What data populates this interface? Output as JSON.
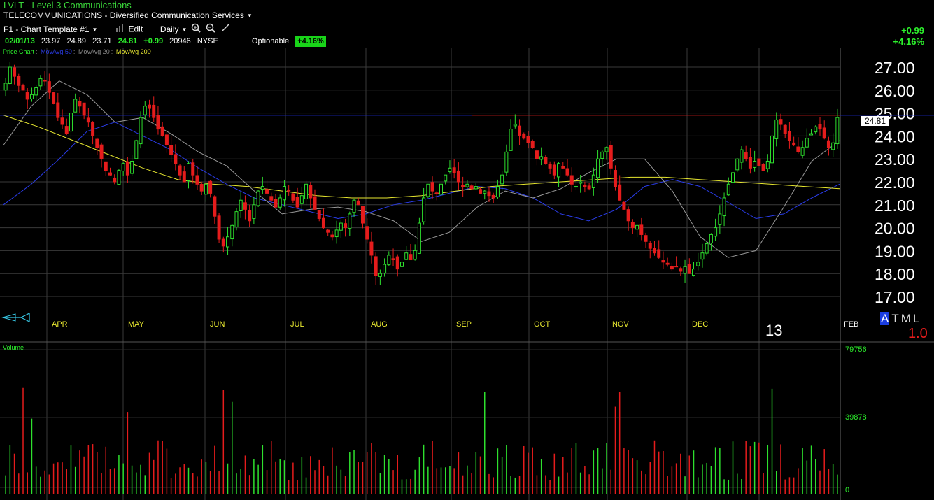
{
  "header": {
    "title": "LVLT - Level 3 Communications",
    "sector": "TELECOMMUNICATIONS - Diversified Communication Services",
    "template": "F1 - Chart Template #1",
    "edit_label": "Edit",
    "period": "Daily",
    "quote": {
      "date": "02/01/13",
      "open": "23.97",
      "high": "24.89",
      "low": "23.71",
      "close": "24.81",
      "change": "+0.99",
      "volume": "20946",
      "exchange": "NYSE",
      "optionable": "Optionable",
      "pct_badge": "+4.16%"
    },
    "change_abs": "+0.99",
    "change_pct": "+4.16%"
  },
  "indicators": [
    {
      "label": "Price Chart",
      "color": "#2cf02c"
    },
    {
      "label": "MovAvg 50",
      "color": "#2a3ce8"
    },
    {
      "label": "MovAvg 20",
      "color": "#8c8c8c"
    },
    {
      "label": "MovAvg 200",
      "color": "#e8e830"
    }
  ],
  "volume_label": "Volume",
  "time_labels": {
    "year": "13",
    "tml": "TML",
    "a_label": "A",
    "zoom": "1.0"
  },
  "chart_data": [
    {
      "type": "candlestick",
      "ylim": [
        16.3,
        27.8
      ],
      "y_ticks": [
        "17.00",
        "18.00",
        "19.00",
        "20.00",
        "21.00",
        "22.00",
        "23.00",
        "24.00",
        "25.00",
        "26.00",
        "27.00"
      ],
      "months": [
        "APR",
        "MAY",
        "JUN",
        "JUL",
        "AUG",
        "SEP",
        "OCT",
        "NOV",
        "DEC",
        "FEB"
      ],
      "last_price": "24.81",
      "resistance_line": 24.9,
      "close_series": [
        26.3,
        27.0,
        26.6,
        26.2,
        26.0,
        25.6,
        25.8,
        26.1,
        26.5,
        26.4,
        25.9,
        25.4,
        24.8,
        24.5,
        24.1,
        25.0,
        25.6,
        25.3,
        24.9,
        24.6,
        24.0,
        23.5,
        23.0,
        22.5,
        22.3,
        22.0,
        22.5,
        22.8,
        22.3,
        22.9,
        23.8,
        24.8,
        25.3,
        25.2,
        24.8,
        24.3,
        24.0,
        23.6,
        23.2,
        22.8,
        22.3,
        22.0,
        22.8,
        22.3,
        21.9,
        21.6,
        21.9,
        21.5,
        20.5,
        19.5,
        19.2,
        19.6,
        20.1,
        20.7,
        21.2,
        20.8,
        20.3,
        21.0,
        21.6,
        21.8,
        21.5,
        21.2,
        20.9,
        21.3,
        21.8,
        21.6,
        21.2,
        20.9,
        21.4,
        21.9,
        21.3,
        20.8,
        20.4,
        20.0,
        19.8,
        19.6,
        19.9,
        20.2,
        20.0,
        20.6,
        21.2,
        21.0,
        20.2,
        19.5,
        18.8,
        17.9,
        18.0,
        18.4,
        18.8,
        18.6,
        18.2,
        18.5,
        18.9,
        18.6,
        19.0,
        20.2,
        21.3,
        21.9,
        21.6,
        21.5,
        21.9,
        22.3,
        22.6,
        22.4,
        22.0,
        21.8,
        21.9,
        21.7,
        21.8,
        21.5,
        21.6,
        21.4,
        21.3,
        21.8,
        22.3,
        23.3,
        24.3,
        24.5,
        24.0,
        23.9,
        23.7,
        23.5,
        23.0,
        23.1,
        22.8,
        22.6,
        22.3,
        22.8,
        22.6,
        22.3,
        21.9,
        21.8,
        22.0,
        21.8,
        21.7,
        22.3,
        23.0,
        23.3,
        23.5,
        22.6,
        21.8,
        21.2,
        20.8,
        20.3,
        20.0,
        20.1,
        19.7,
        19.4,
        19.1,
        18.9,
        18.7,
        18.5,
        18.4,
        18.2,
        18.3,
        18.1,
        18.3,
        18.0,
        18.2,
        18.5,
        18.9,
        19.3,
        19.7,
        20.0,
        20.6,
        21.3,
        21.9,
        22.4,
        23.0,
        23.4,
        23.0,
        22.6,
        22.9,
        22.7,
        22.5,
        22.9,
        24.0,
        24.7,
        24.5,
        24.1,
        23.8,
        23.6,
        23.3,
        23.5,
        23.9,
        24.1,
        24.4,
        24.3,
        23.9,
        23.5,
        23.7,
        24.8
      ],
      "series": [
        {
          "name": "MovAvg 50",
          "values": [
            21.0,
            21.9,
            23.0,
            24.2,
            24.6,
            24.0,
            23.4,
            22.6,
            21.9,
            21.3,
            21.0,
            20.7,
            20.4,
            20.6,
            21.0,
            21.2,
            21.5,
            21.8,
            21.7,
            21.3,
            20.6,
            20.3,
            20.8,
            21.8,
            22.1,
            21.8,
            21.1,
            20.4,
            20.6,
            21.3,
            21.9
          ]
        },
        {
          "name": "MovAvg 20",
          "values": [
            23.6,
            25.3,
            26.4,
            25.8,
            24.6,
            24.8,
            24.1,
            23.3,
            22.7,
            21.6,
            20.6,
            20.8,
            20.9,
            20.7,
            20.3,
            19.4,
            19.8,
            20.9,
            21.6,
            21.3,
            21.7,
            22.4,
            23.0,
            23.0,
            21.6,
            19.6,
            18.7,
            19.0,
            20.9,
            22.9,
            23.8
          ]
        },
        {
          "name": "MovAvg 200",
          "values": [
            24.9,
            24.4,
            23.8,
            23.2,
            22.6,
            22.1,
            21.9,
            21.8,
            21.6,
            21.4,
            21.3,
            21.3,
            21.4,
            21.6,
            21.8,
            21.9,
            22.0,
            22.1,
            22.2,
            22.2,
            22.1,
            22.0,
            21.9,
            21.8,
            21.7
          ]
        }
      ]
    },
    {
      "type": "bar",
      "title": "Volume",
      "y_ticks": [
        "79756",
        "39878",
        "0"
      ],
      "ylim": [
        0,
        79756
      ]
    }
  ]
}
